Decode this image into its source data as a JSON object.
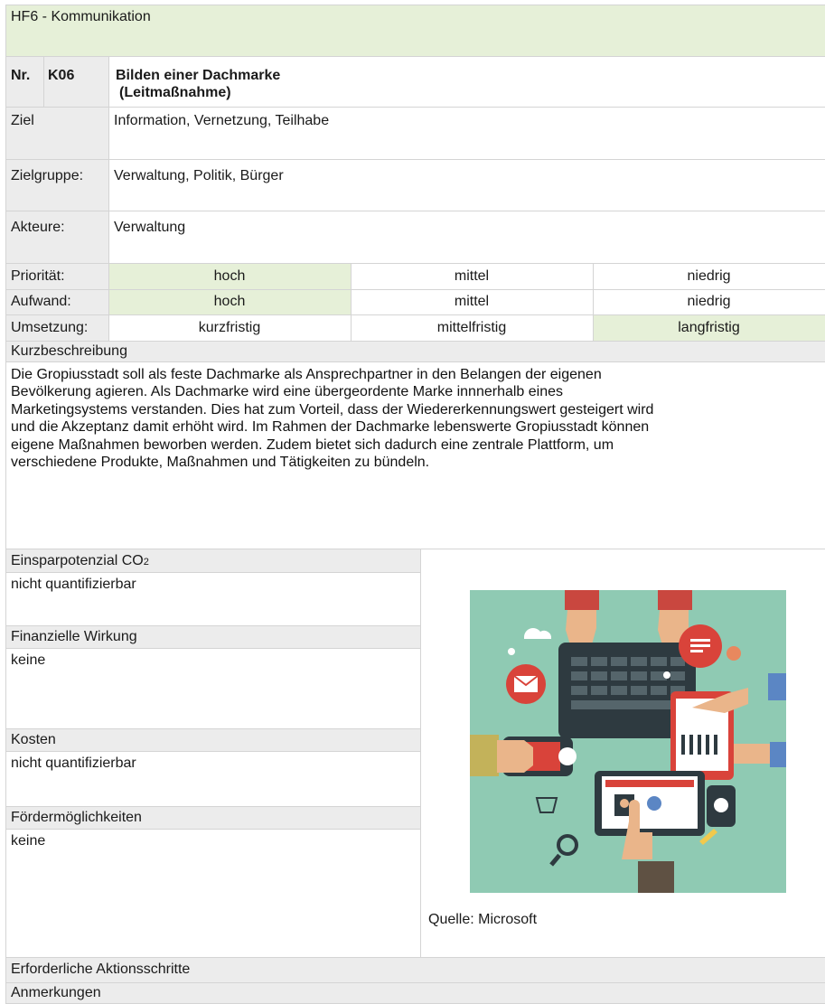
{
  "header": {
    "title": "HF6 - Kommunikation"
  },
  "measure": {
    "nr_label": "Nr.",
    "nr_value": "K06",
    "title": "Bilden einer Dachmarke",
    "subtitle": "(Leitmaßnahme)"
  },
  "rows": {
    "ziel_label": "Ziel",
    "ziel_value": "Information, Vernetzung, Teilhabe",
    "zielgruppe_label": "Zielgruppe:",
    "zielgruppe_value": "Verwaltung, Politik, Bürger",
    "akteure_label": "Akteure:",
    "akteure_value": "Verwaltung"
  },
  "ratings": {
    "prioritaet": {
      "label": "Priorität:",
      "options": [
        "hoch",
        "mittel",
        "niedrig"
      ],
      "selected": "hoch"
    },
    "aufwand": {
      "label": "Aufwand:",
      "options": [
        "hoch",
        "mittel",
        "niedrig"
      ],
      "selected": "hoch"
    },
    "umsetzung": {
      "label": "Umsetzung:",
      "options": [
        "kurzfristig",
        "mittelfristig",
        "langfristig"
      ],
      "selected": "langfristig"
    }
  },
  "kurzbeschreibung": {
    "label": "Kurzbeschreibung",
    "lines": [
      "Die Gropiusstadt soll als feste Dachmarke als Ansprechpartner in den Belangen der eigenen",
      "Bevölkerung agieren. Als Dachmarke wird eine übergeordente Marke innnerhalb eines",
      "Marketingsystems verstanden. Dies hat zum Vorteil, dass der Wiedererkennungswert gesteigert wird",
      "und die Akzeptanz damit erhöht wird. Im Rahmen der Dachmarke lebenswerte Gropiusstadt können",
      "eigene Maßnahmen beworben werden. Zudem bietet sich dadurch eine zentrale Plattform, um",
      "verschiedene Produkte, Maßnahmen und Tätigkeiten zu bündeln."
    ]
  },
  "details": {
    "co2_label": "Einsparpotenzial CO",
    "co2_sub": "2",
    "co2_value": "nicht quantifizierbar",
    "finanz_label": "Finanzielle Wirkung",
    "finanz_value": "keine",
    "kosten_label": "Kosten",
    "kosten_value": "nicht quantifizierbar",
    "foerder_label": "Fördermöglichkeiten",
    "foerder_value": "keine"
  },
  "image": {
    "caption": "Quelle: Microsoft"
  },
  "footer": {
    "aktionsschritte_label": "Erforderliche Aktionsschritte",
    "anmerkungen_label": "Anmerkungen"
  },
  "colors": {
    "highlight_green": "#e6f0d8",
    "label_grey": "#ececec",
    "illustration_bg": "#8fcab3"
  }
}
